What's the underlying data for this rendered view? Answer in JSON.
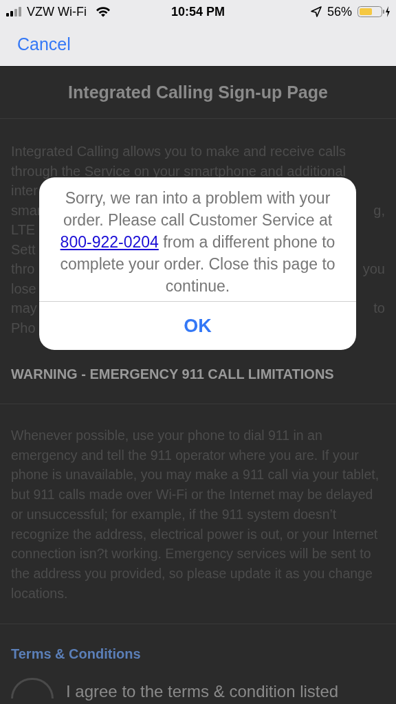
{
  "status_bar": {
    "carrier": "VZW Wi-Fi",
    "time": "10:54 PM",
    "battery": "56%"
  },
  "nav": {
    "cancel": "Cancel"
  },
  "page": {
    "title": "Integrated Calling Sign-up Page",
    "intro_lines": [
      {
        "left": "Integrated Calling allows you to make and receive calls"
      },
      {
        "left": "through the Service on your smartphone and additional"
      },
      {
        "left": "inter"
      },
      {
        "left": "smar",
        "right": "g,"
      },
      {
        "left": "LTE"
      },
      {
        "left": "Sett"
      },
      {
        "left": "thro",
        "right": "you"
      },
      {
        "left": "lose"
      },
      {
        "left": "may",
        "right": "to"
      },
      {
        "left": "Pho"
      }
    ],
    "warning_heading": "WARNING - EMERGENCY 911 CALL LIMITATIONS",
    "warning_text": "Whenever possible, use your phone to dial 911 in an emergency and tell the 911 operator where you are. If your phone is unavailable, you may make a 911 call via your tablet, but 911 calls made over Wi-Fi or the Internet may be delayed or unsuccessful; for example, if the 911 system doesn’t recognize the address, electrical power is out, or your Internet connection isn?t working. Emergency services will be sent to the address you provided, so please update it as you change locations.",
    "terms_heading": "Terms & Conditions",
    "agree": {
      "label": "I agree to the terms & condition listed",
      "checked": false
    }
  },
  "alert": {
    "before": "Sorry, we ran into a problem with your order. Please call Customer Service at",
    "phone": "800-922-0204",
    "after": "from a different phone to complete your order. Close this page to continue.",
    "button": "OK"
  }
}
